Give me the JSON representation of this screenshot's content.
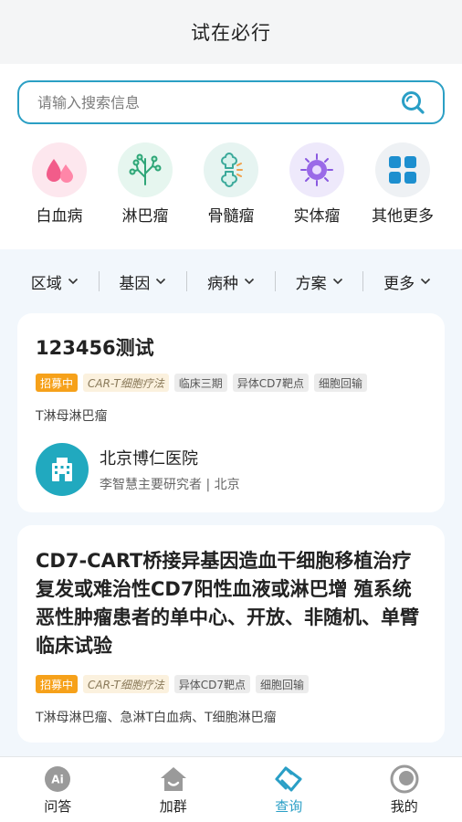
{
  "header": {
    "title": "试在必行"
  },
  "search": {
    "placeholder": "请输入搜索信息"
  },
  "categories": [
    {
      "label": "白血病",
      "icon": "blood-drops-icon",
      "bg": "#fde7ee"
    },
    {
      "label": "淋巴瘤",
      "icon": "lymph-icon",
      "bg": "#e6f6ef"
    },
    {
      "label": "骨髓瘤",
      "icon": "bone-icon",
      "bg": "#e6f4f1"
    },
    {
      "label": "实体瘤",
      "icon": "cell-icon",
      "bg": "#eee9fb"
    },
    {
      "label": "其他更多",
      "icon": "grid-icon",
      "bg": "#eef1f4"
    }
  ],
  "filters": [
    "区域",
    "基因",
    "病种",
    "方案",
    "更多"
  ],
  "cards": [
    {
      "title": "123456测试",
      "tags": [
        "招募中",
        "CAR-T细胞疗法",
        "临床三期",
        "异体CD7靶点",
        "细胞回输"
      ],
      "disease": "T淋母淋巴瘤",
      "hospital": "北京博仁医院",
      "pi": "李智慧主要研究者 | 北京"
    },
    {
      "title": "CD7-CART桥接异基因造血干细胞移植治疗复发或难治性CD7阳性血液或淋巴增 殖系统恶性肿瘤患者的单中心、开放、非随机、单臂临床试验",
      "tags": [
        "招募中",
        "CAR-T细胞疗法",
        "异体CD7靶点",
        "细胞回输"
      ],
      "disease": "T淋母淋巴瘤、急淋T白血病、T细胞淋巴瘤"
    }
  ],
  "tabbar": [
    {
      "label": "问答",
      "icon": "ai-icon"
    },
    {
      "label": "加群",
      "icon": "house-icon"
    },
    {
      "label": "查询",
      "icon": "handshake-icon",
      "active": true
    },
    {
      "label": "我的",
      "icon": "profile-icon"
    }
  ],
  "colors": {
    "accent": "#2a9fc6",
    "status_tag": "#f6a11a",
    "hospital_logo": "#21a9bf"
  }
}
